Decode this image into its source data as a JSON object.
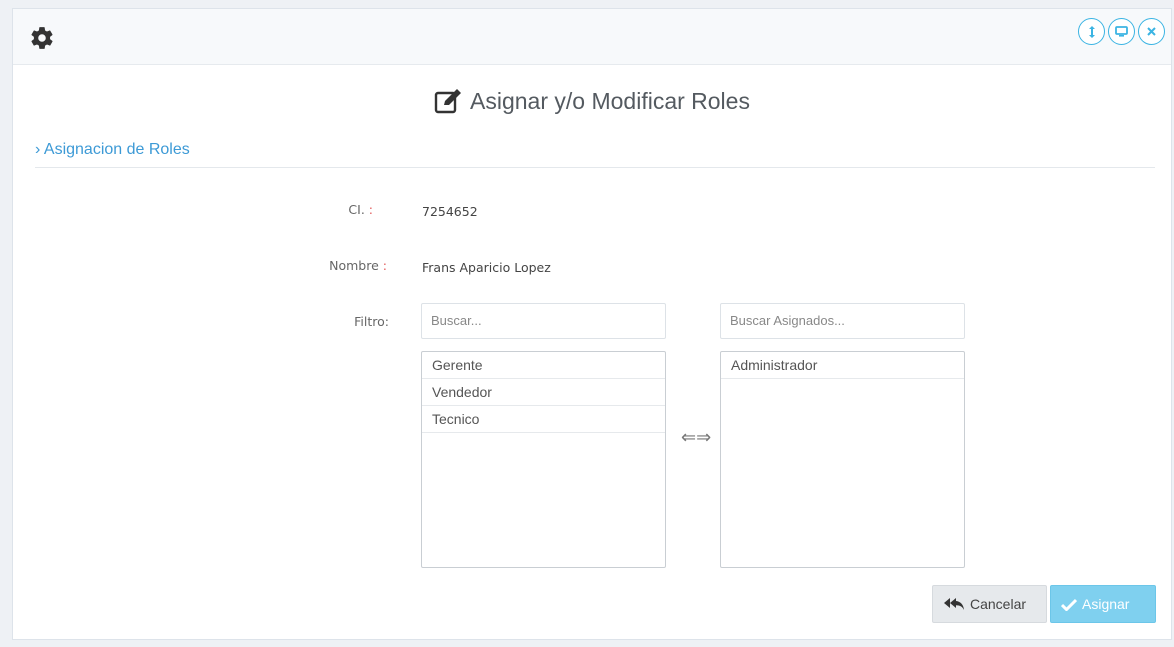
{
  "header": {
    "icon": "gear-icon",
    "buttons": [
      {
        "name": "collapse-button",
        "icon": "resize-vertical-icon"
      },
      {
        "name": "fullscreen-button",
        "icon": "monitor-icon"
      },
      {
        "name": "close-button",
        "icon": "close-icon"
      }
    ]
  },
  "title": "Asignar y/o Modificar Roles",
  "section": "› Asignacion de Roles",
  "form": {
    "ci_label": "CI.",
    "ci_colon": ":",
    "ci_value": "7254652",
    "nombre_label": "Nombre",
    "nombre_colon": ":",
    "nombre_value": "Frans Aparicio Lopez",
    "filtro_label": "Filtro:",
    "search_available_placeholder": "Buscar...",
    "search_assigned_placeholder": "Buscar Asignados...",
    "available_roles": [
      "Gerente",
      "Vendedor",
      "Tecnico"
    ],
    "assigned_roles": [
      "Administrador"
    ],
    "swap_icon": "⇐⇒"
  },
  "actions": {
    "cancel_label": "Cancelar",
    "assign_label": "Asignar"
  },
  "colors": {
    "accent": "#3bb4e3",
    "section": "#3d9ad6",
    "assign_button": "#7fd0ef"
  }
}
